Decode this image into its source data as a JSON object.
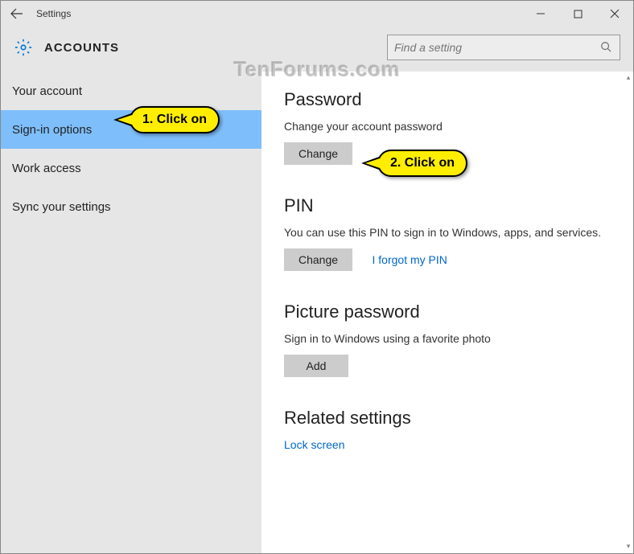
{
  "titlebar": {
    "title": "Settings"
  },
  "header": {
    "title": "ACCOUNTS"
  },
  "search": {
    "placeholder": "Find a setting"
  },
  "sidebar": {
    "items": [
      {
        "label": "Your account"
      },
      {
        "label": "Sign-in options"
      },
      {
        "label": "Work access"
      },
      {
        "label": "Sync your settings"
      }
    ]
  },
  "sections": {
    "password": {
      "heading": "Password",
      "desc": "Change your account password",
      "button": "Change"
    },
    "pin": {
      "heading": "PIN",
      "desc": "You can use this PIN to sign in to Windows, apps, and services.",
      "button": "Change",
      "link": "I forgot my PIN"
    },
    "picture": {
      "heading": "Picture password",
      "desc": "Sign in to Windows using a favorite photo",
      "button": "Add"
    },
    "related": {
      "heading": "Related settings",
      "link": "Lock screen"
    }
  },
  "callouts": {
    "c1": "1. Click on",
    "c2": "2. Click on"
  },
  "watermark": "TenForums.com"
}
